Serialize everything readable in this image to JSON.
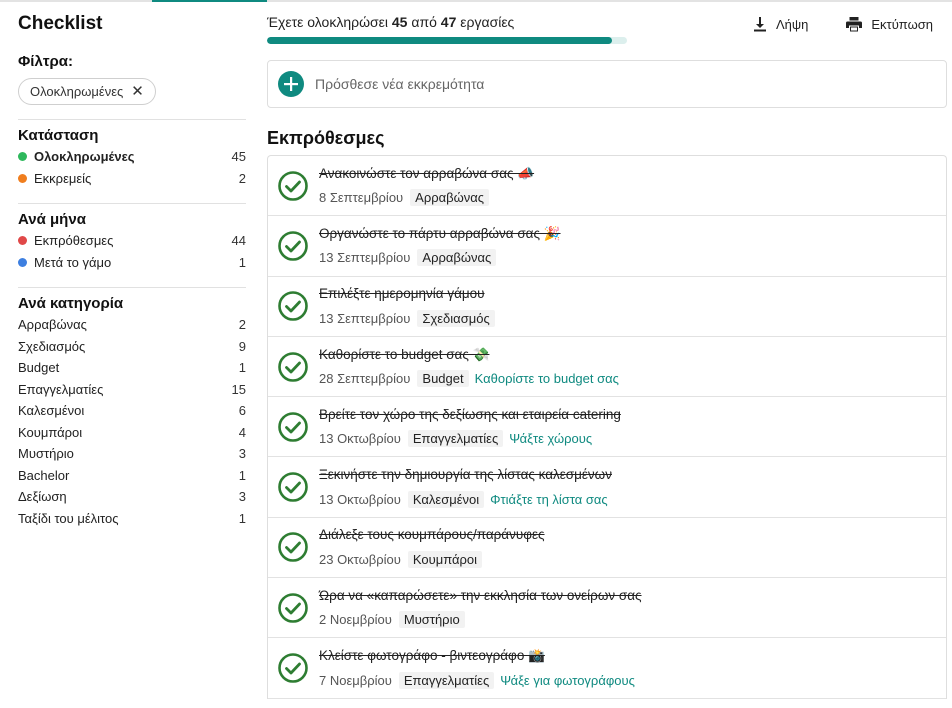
{
  "sidebar": {
    "title": "Checklist",
    "filters_label": "Φίλτρα:",
    "active_filter": "Ολοκληρωμένες",
    "sections": [
      {
        "title": "Κατάσταση",
        "items": [
          {
            "label": "Ολοκληρωμένες",
            "count": "45",
            "dot": "#2eb85c",
            "active": true
          },
          {
            "label": "Εκκρεμείς",
            "count": "2",
            "dot": "#f07e1e"
          }
        ]
      },
      {
        "title": "Ανά μήνα",
        "items": [
          {
            "label": "Εκπρόθεσμες",
            "count": "44",
            "dot": "#e04848"
          },
          {
            "label": "Μετά το γάμο",
            "count": "1",
            "dot": "#3d7fe0"
          }
        ]
      },
      {
        "title": "Ανά κατηγορία",
        "items": [
          {
            "label": "Αρραβώνας",
            "count": "2"
          },
          {
            "label": "Σχεδιασμός",
            "count": "9"
          },
          {
            "label": "Budget",
            "count": "1"
          },
          {
            "label": "Επαγγελματίες",
            "count": "15"
          },
          {
            "label": "Καλεσμένοι",
            "count": "6"
          },
          {
            "label": "Κουμπάροι",
            "count": "4"
          },
          {
            "label": "Μυστήριο",
            "count": "3"
          },
          {
            "label": "Bachelor",
            "count": "1"
          },
          {
            "label": "Δεξίωση",
            "count": "3"
          },
          {
            "label": "Ταξίδι του μέλιτος",
            "count": "1"
          }
        ]
      }
    ]
  },
  "progress": {
    "prefix": "Έχετε ολοκληρώσει",
    "done": "45",
    "middle": "από",
    "total": "47",
    "suffix": "εργασίες",
    "fraction": 0.957
  },
  "actions": {
    "download": "Λήψη",
    "print": "Εκτύπωση"
  },
  "add_task": {
    "placeholder": "Πρόσθεσε νέα εκκρεμότητα"
  },
  "section_heading": "Εκπρόθεσμες",
  "tasks": [
    {
      "title": "Ανακοινώστε τον αρραβώνα σας 📣",
      "date": "8 Σεπτεμβρίου",
      "tag": "Αρραβώνας",
      "link": ""
    },
    {
      "title": "Οργανώστε το πάρτυ αρραβώνα σας 🎉",
      "date": "13 Σεπτεμβρίου",
      "tag": "Αρραβώνας",
      "link": ""
    },
    {
      "title": "Επιλέξτε ημερομηνία γάμου",
      "date": "13 Σεπτεμβρίου",
      "tag": "Σχεδιασμός",
      "link": ""
    },
    {
      "title": "Καθορίστε το budget σας 💸",
      "date": "28 Σεπτεμβρίου",
      "tag": "Budget",
      "link": "Καθορίστε το budget σας"
    },
    {
      "title": "Βρείτε τον χώρο της δεξίωσης και εταιρεία catering",
      "date": "13 Οκτωβρίου",
      "tag": "Επαγγελματίες",
      "link": "Ψάξτε χώρους"
    },
    {
      "title": "Ξεκινήστε την δημιουργία της λίστας καλεσμένων",
      "date": "13 Οκτωβρίου",
      "tag": "Καλεσμένοι",
      "link": "Φτιάξτε τη λίστα σας"
    },
    {
      "title": "Διάλεξε τους κουμπάρους/παράνυφες",
      "date": "23 Οκτωβρίου",
      "tag": "Κουμπάροι",
      "link": ""
    },
    {
      "title": "Ώρα να «καπαρώσετε» την εκκλησία των ονείρων σας",
      "date": "2 Νοεμβρίου",
      "tag": "Μυστήριο",
      "link": ""
    },
    {
      "title": "Κλείστε φωτογράφο - βιντεογράφο 📸",
      "date": "7 Νοεμβρίου",
      "tag": "Επαγγελματίες",
      "link": "Ψάξε για φωτογράφους"
    }
  ]
}
